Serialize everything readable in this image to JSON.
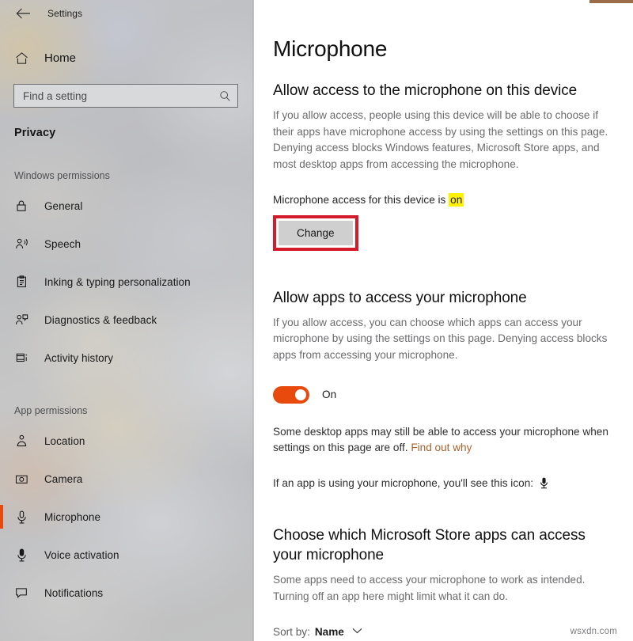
{
  "window": {
    "app_title": "Settings",
    "back_icon": "arrow-left-icon",
    "accent_strip_color": "#9c6b4a"
  },
  "sidebar": {
    "home": {
      "label": "Home",
      "icon": "home-icon"
    },
    "search": {
      "placeholder": "Find a setting",
      "icon": "search-icon",
      "value": ""
    },
    "category": "Privacy",
    "groups": [
      {
        "heading": "Windows permissions",
        "items": [
          {
            "label": "General",
            "icon": "lock-icon",
            "selected": false
          },
          {
            "label": "Speech",
            "icon": "speech-person-icon",
            "selected": false
          },
          {
            "label": "Inking & typing personalization",
            "icon": "clipboard-pen-icon",
            "selected": false
          },
          {
            "label": "Diagnostics & feedback",
            "icon": "person-feedback-icon",
            "selected": false
          },
          {
            "label": "Activity history",
            "icon": "activity-history-icon",
            "selected": false
          }
        ]
      },
      {
        "heading": "App permissions",
        "items": [
          {
            "label": "Location",
            "icon": "location-pin-icon",
            "selected": false
          },
          {
            "label": "Camera",
            "icon": "camera-icon",
            "selected": false
          },
          {
            "label": "Microphone",
            "icon": "microphone-icon",
            "selected": true
          },
          {
            "label": "Voice activation",
            "icon": "voice-activation-icon",
            "selected": false
          },
          {
            "label": "Notifications",
            "icon": "notification-icon",
            "selected": false
          }
        ]
      }
    ],
    "selection_color": "#e8490d"
  },
  "main": {
    "page_title": "Microphone",
    "section_device": {
      "heading": "Allow access to the microphone on this device",
      "description": "If you allow access, people using this device will be able to choose if their apps have microphone access by using the settings on this page. Denying access blocks Windows features, Microsoft Store apps, and most desktop apps from accessing the microphone.",
      "status_prefix": "Microphone access for this device is ",
      "status_value": "on",
      "status_highlight_color": "#fff200",
      "change_button": "Change",
      "annotation_color": "#d41b2c"
    },
    "section_apps": {
      "heading": "Allow apps to access your microphone",
      "description": "If you allow access, you can choose which apps can access your microphone by using the settings on this page. Denying access blocks apps from accessing your microphone.",
      "toggle_state": "On",
      "toggle_color": "#e8490d",
      "note_text": "Some desktop apps may still be able to access your microphone when settings on this page are off. ",
      "note_link": "Find out why",
      "link_color": "#a9622c",
      "icon_line": "If an app is using your microphone, you'll see this icon:",
      "icon_name": "microphone-icon"
    },
    "section_store": {
      "heading": "Choose which Microsoft Store apps can access your microphone",
      "description": "Some apps need to access your microphone to work as intended. Turning off an app here might limit what it can do.",
      "sort_prefix": "Sort by:",
      "sort_value": "Name",
      "sort_icon": "chevron-down-icon"
    }
  },
  "watermark": "wsxdn.com"
}
